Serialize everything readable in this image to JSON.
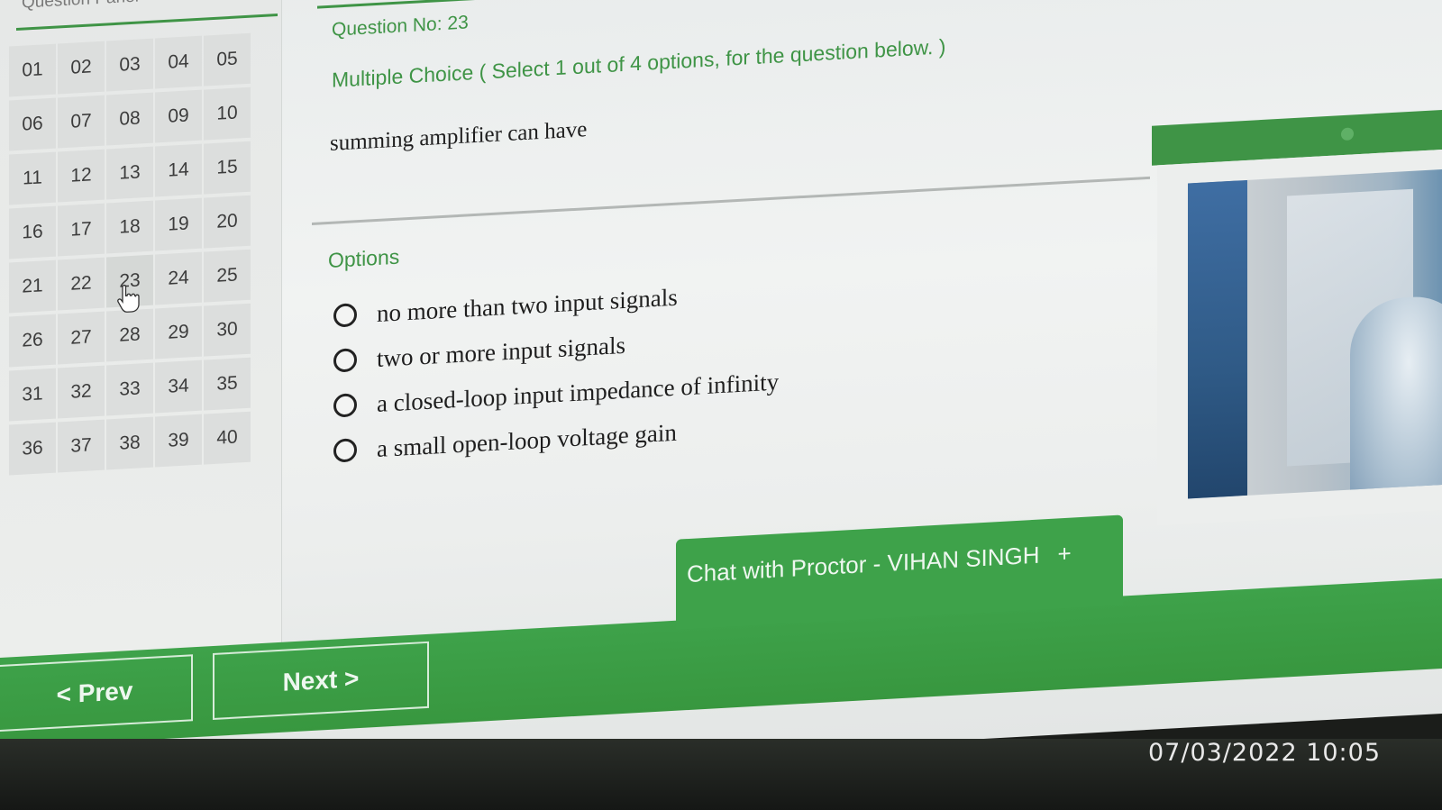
{
  "question_panel": {
    "title": "Question Panel",
    "numbers": [
      "01",
      "02",
      "03",
      "04",
      "05",
      "06",
      "07",
      "08",
      "09",
      "10",
      "11",
      "12",
      "13",
      "14",
      "15",
      "16",
      "17",
      "18",
      "19",
      "20",
      "21",
      "22",
      "23",
      "24",
      "25",
      "26",
      "27",
      "28",
      "29",
      "30",
      "31",
      "32",
      "33",
      "34",
      "35",
      "36",
      "37",
      "38",
      "39",
      "40"
    ],
    "current": "23"
  },
  "question": {
    "number_label": "Question No: 23",
    "type_label": "Multiple Choice ( Select 1 out of 4 options, for the question below. )",
    "text": "summing amplifier can have",
    "options_label": "Options",
    "options": [
      "no more than two input signals",
      "two or more input signals",
      "a closed-loop input impedance of infinity",
      "a small open-loop voltage gain"
    ]
  },
  "chat": {
    "label": "Chat with Proctor - VIHAN SINGH",
    "expand_symbol": "+"
  },
  "navigation": {
    "prev_label": "< Prev",
    "next_label": "Next >"
  },
  "photo_timestamp": "07/03/2022 10:05",
  "colors": {
    "accent": "#3f9446",
    "footer": "#3ea24a"
  }
}
